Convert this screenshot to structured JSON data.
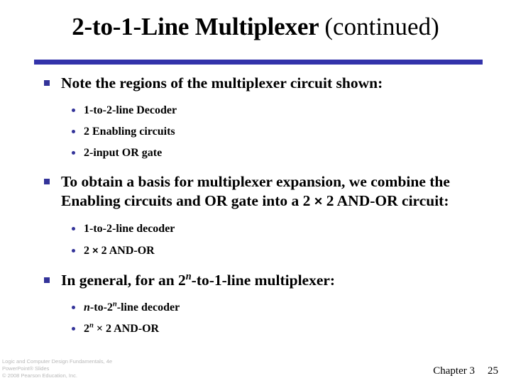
{
  "slide": {
    "title_main": "2-to-1-Line Multiplexer ",
    "title_suffix": "(continued)",
    "divider_color": "#3333aa",
    "bullet_color": "#333399"
  },
  "content": {
    "bullet1": {
      "text": "Note the regions of the multiplexer circuit shown:",
      "sub": [
        "1-to-2-line Decoder",
        "2 Enabling circuits",
        "2-input OR gate"
      ]
    },
    "bullet2": {
      "text_part1": "To obtain a basis for multiplexer expansion, we combine the Enabling circuits and OR gate into a 2 ",
      "text_times": "×",
      "text_part2": " 2 AND-OR circuit:",
      "sub": [
        {
          "text_part1": "1-to-2-line decoder",
          "text_times": "",
          "text_part2": ""
        },
        {
          "text_part1": "2 ",
          "text_times": "×",
          "text_part2": " 2 AND-OR"
        }
      ]
    },
    "bullet3": {
      "text_part1": "In general, for an 2",
      "sup": "n",
      "text_part2": "-to-1-line multiplexer:",
      "sub": [
        {
          "pre_ital": "n",
          "mid": "-to-2",
          "sup": "n",
          "post": "-line decoder"
        },
        {
          "pre_ital": "",
          "mid": "2",
          "sup": "n",
          "post": " × 2 AND-OR"
        }
      ]
    }
  },
  "footer": {
    "credit_line1": "Logic and Computer Design Fundamentals, 4e",
    "credit_line2": "PowerPoint® Slides",
    "credit_line3": "© 2008 Pearson Education, Inc.",
    "chapter": "Chapter 3",
    "page": "25"
  }
}
